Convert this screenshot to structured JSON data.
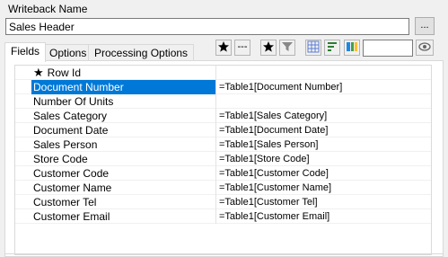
{
  "header": {
    "title": "Writeback Name"
  },
  "name_field": {
    "value": "Sales Header"
  },
  "ellipsis_button": {
    "label": "..."
  },
  "tabs": [
    {
      "label": "Fields",
      "active": true
    },
    {
      "label": "Options",
      "active": false
    },
    {
      "label": "Processing Options",
      "active": false
    }
  ],
  "toolbar": {
    "icons": [
      "star-icon",
      "dash-icon",
      "star-selected-icon",
      "filter-icon",
      "grid-icon",
      "sort-icon",
      "columns-icon",
      "search-toggle-icon"
    ],
    "dash_label": "---",
    "search_value": ""
  },
  "grid": {
    "rows": [
      {
        "name": "Row Id",
        "value": "",
        "star": true,
        "selected": false
      },
      {
        "name": "Document Number",
        "value": "=Table1[Document Number]",
        "star": false,
        "selected": true
      },
      {
        "name": "Number Of Units",
        "value": "",
        "star": false,
        "selected": false
      },
      {
        "name": "Sales Category",
        "value": "=Table1[Sales Category]",
        "star": false,
        "selected": false
      },
      {
        "name": "Document Date",
        "value": "=Table1[Document Date]",
        "star": false,
        "selected": false
      },
      {
        "name": "Sales Person",
        "value": "=Table1[Sales Person]",
        "star": false,
        "selected": false
      },
      {
        "name": "Store Code",
        "value": "=Table1[Store Code]",
        "star": false,
        "selected": false
      },
      {
        "name": "Customer Code",
        "value": "=Table1[Customer Code]",
        "star": false,
        "selected": false
      },
      {
        "name": "Customer Name",
        "value": "=Table1[Customer Name]",
        "star": false,
        "selected": false
      },
      {
        "name": "Customer Tel",
        "value": "=Table1[Customer Tel]",
        "star": false,
        "selected": false
      },
      {
        "name": "Customer Email",
        "value": "=Table1[Customer Email]",
        "star": false,
        "selected": false
      }
    ]
  },
  "colors": {
    "selection": "#0078d7",
    "background": "#f0f0f0"
  }
}
